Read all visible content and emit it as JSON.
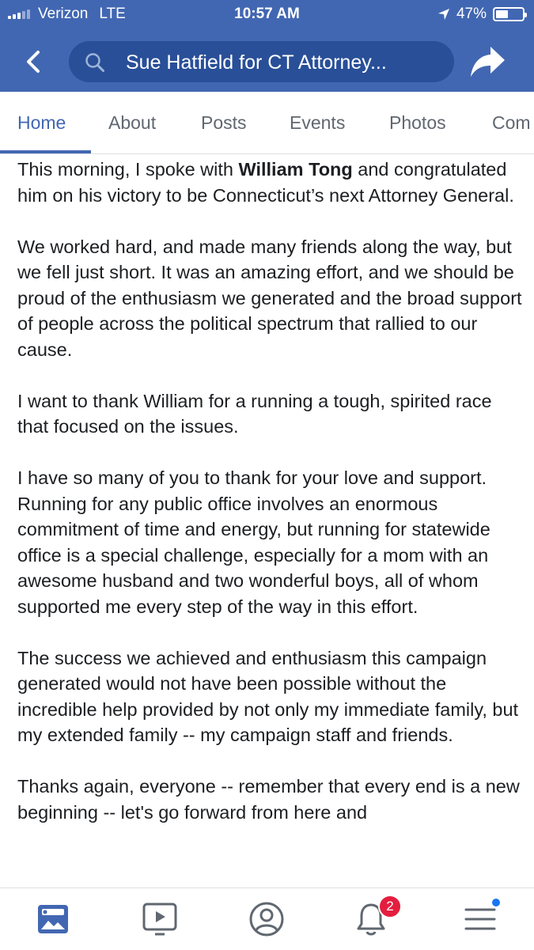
{
  "status_bar": {
    "carrier": "Verizon",
    "network": "LTE",
    "time": "10:57 AM",
    "battery_text": "47%",
    "battery_level": 0.47
  },
  "header": {
    "search_title": "Sue Hatfield for CT Attorney...",
    "brand_color": "#4267b2"
  },
  "tabs": [
    {
      "label": "Home",
      "active": true
    },
    {
      "label": "About"
    },
    {
      "label": "Posts"
    },
    {
      "label": "Events"
    },
    {
      "label": "Photos"
    },
    {
      "label": "Com"
    }
  ],
  "post": {
    "p1": {
      "before": "This morning, I spoke with ",
      "bold": "William Tong",
      "after": " and congratulated him on his victory to be Connecticut’s next Attorney General."
    },
    "p2": "We worked hard, and made many friends along the way, but we fell just short. It was an amazing effort, and we should be proud of the enthusiasm we generated and the broad support of people across the political spectrum that rallied to our cause.",
    "p3": "I want to thank William for a running a tough, spirited race that focused on the issues.",
    "p4": "I have so many of you to thank for your love and support. Running for any public office involves an enormous commitment of time and energy, but running for statewide office is a special challenge, especially for a mom with an awesome husband and two wonderful boys, all of whom supported me every step of the way in this effort.",
    "p5": "The success we achieved and enthusiasm this campaign generated would not have been possible without the incredible help provided by not only my immediate family, but my extended family -- my campaign staff and friends.",
    "p6": "Thanks again, everyone -- remember that every end is a new beginning -- let's go forward from here and"
  },
  "bottom_nav": {
    "items": [
      "news-feed-icon",
      "video-icon",
      "profile-icon",
      "notifications-icon",
      "menu-icon"
    ],
    "notification_count": "2"
  }
}
